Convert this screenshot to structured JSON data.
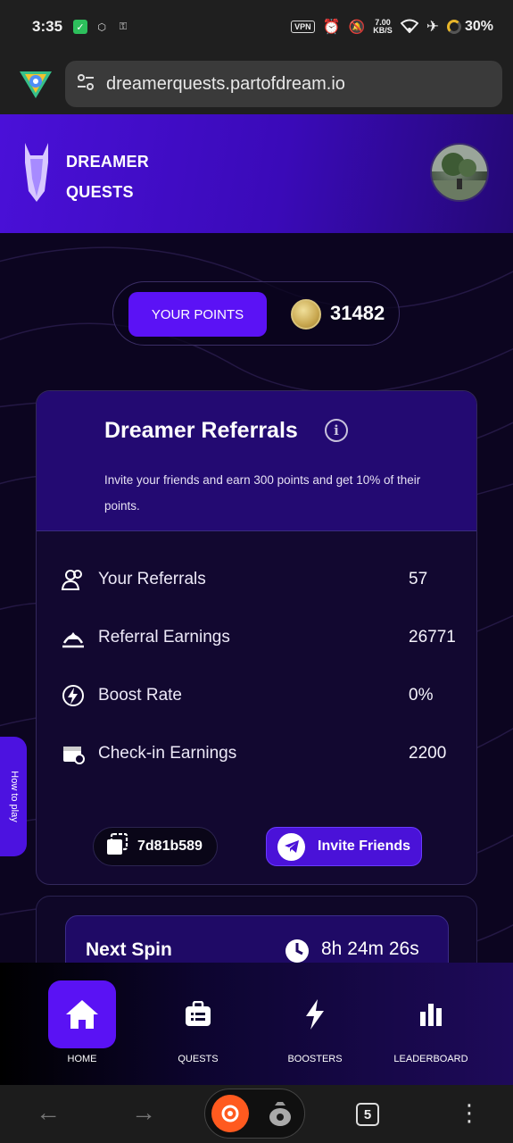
{
  "status_bar": {
    "time": "3:35",
    "vpn": "VPN",
    "speed_value": "7.00",
    "speed_unit": "KB/S",
    "battery": "30%"
  },
  "browser": {
    "url": "dreamerquests.partofdream.io",
    "tab_count": "5"
  },
  "header": {
    "brand_line1": "DREAMER",
    "brand_line2": "QUESTS"
  },
  "points": {
    "label": "YOUR POINTS",
    "value": "31482"
  },
  "referrals": {
    "title": "Dreamer Referrals",
    "description": "Invite your friends and earn 300 points and get 10% of their points.",
    "stats": [
      {
        "label": "Your Referrals",
        "value": "57",
        "icon": "users-icon"
      },
      {
        "label": "Referral Earnings",
        "value": "26771",
        "icon": "earnings-icon"
      },
      {
        "label": "Boost Rate",
        "value": "0%",
        "icon": "boost-icon"
      },
      {
        "label": "Check-in Earnings",
        "value": "2200",
        "icon": "calendar-icon"
      }
    ],
    "code": "7d81b589",
    "invite_label": "Invite Friends"
  },
  "how_to_play": "How to play",
  "spin": {
    "label": "Next Spin",
    "time": "8h 24m 26s"
  },
  "nav": [
    {
      "label": "HOME",
      "icon": "home-icon",
      "active": true
    },
    {
      "label": "QUESTS",
      "icon": "quests-icon",
      "active": false
    },
    {
      "label": "BOOSTERS",
      "icon": "lightning-icon",
      "active": false
    },
    {
      "label": "LEADERBOARD",
      "icon": "bar-chart-icon",
      "active": false
    }
  ],
  "colors": {
    "accent": "#5b12f5",
    "header": "#3a0ab8",
    "background": "#0c0520"
  }
}
